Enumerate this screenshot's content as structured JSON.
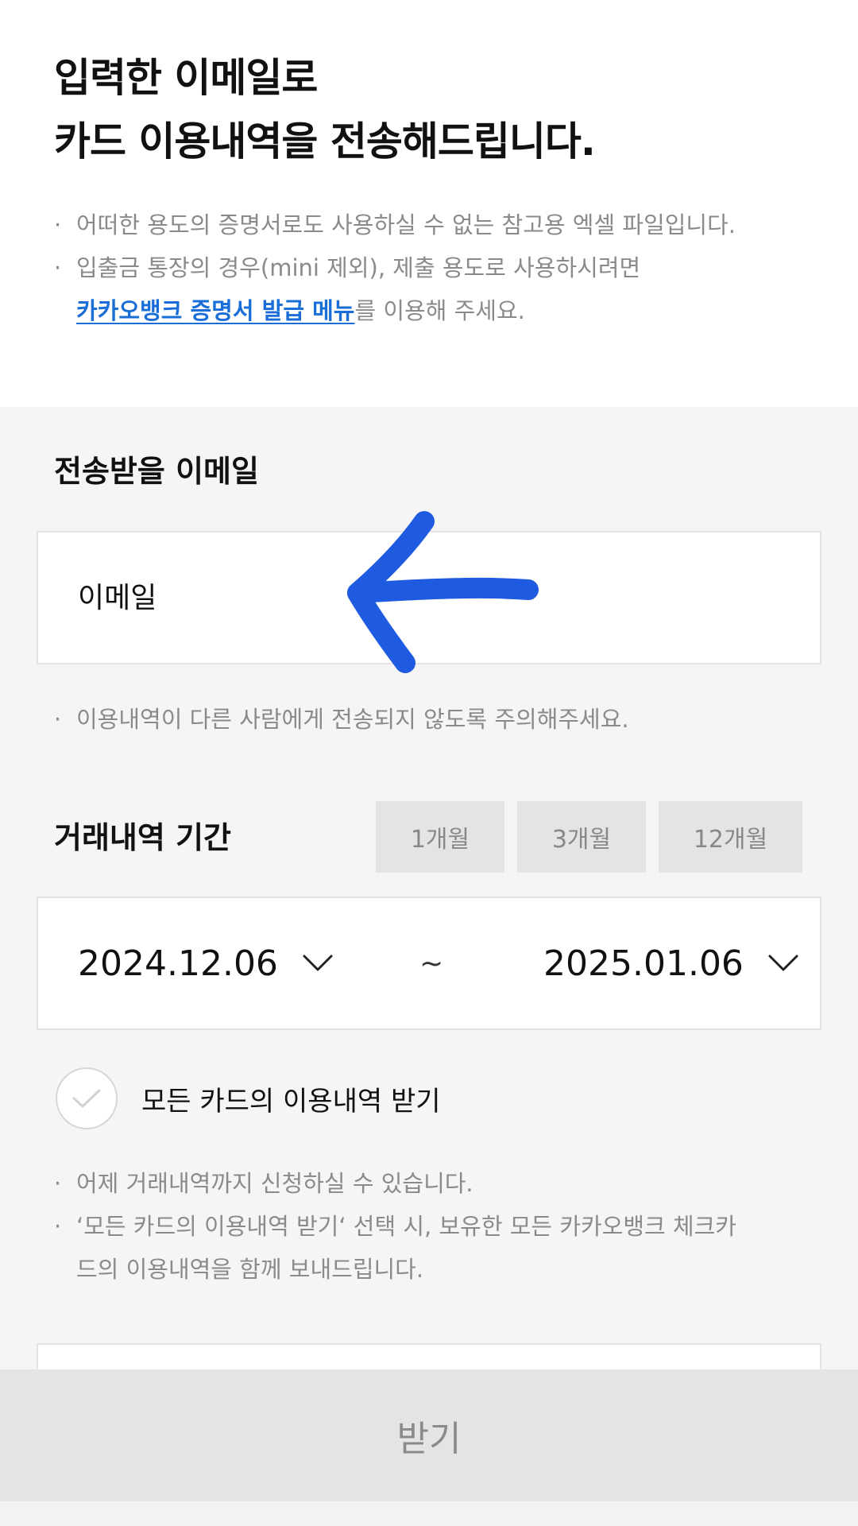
{
  "header": {
    "title_line1": "입력한 이메일로",
    "title_line2": "카드 이용내역을 전송해드립니다."
  },
  "notes_top": {
    "line1": "어떠한 용도의 증명서로도 사용하실 수 없는 참고용 엑셀 파일입니다.",
    "line2": "입출금 통장의 경우(mini 제외), 제출 용도로 사용하시려면",
    "link": "카카오뱅크 증명서 발급 메뉴",
    "line3_suffix": "를 이용해 주세요."
  },
  "email_section": {
    "label": "전송받을 이메일",
    "placeholder": "이메일",
    "warning": "이용내역이 다른 사람에게 전송되지 않도록 주의해주세요."
  },
  "period_section": {
    "label": "거래내역 기간",
    "buttons": [
      "1개월",
      "3개월",
      "12개월"
    ],
    "start_date": "2024.12.06",
    "separator": "~",
    "end_date": "2025.01.06"
  },
  "all_cards": {
    "label": "모든 카드의 이용내역 받기",
    "checked": false
  },
  "notes_bottom": {
    "line1": "어제 거래내역까지 신청하실 수 있습니다.",
    "line2": "‘모든 카드의 이용내역 받기‘ 선택 시, 보유한 모든 카카오뱅크 체크카",
    "line3": "드의 이용내역을 함께 보내드립니다."
  },
  "submit": {
    "label": "받기"
  },
  "colors": {
    "accent_link": "#1a6ed8",
    "annotation_arrow": "#1f5be0",
    "button_bg": "#e4e4e4"
  }
}
